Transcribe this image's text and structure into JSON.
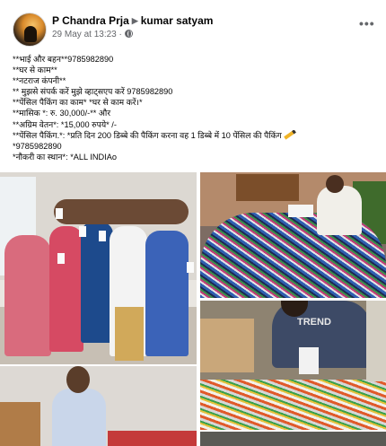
{
  "post": {
    "author": "P Chandra Prja",
    "recipient": "kumar satyam",
    "timestamp": "29 May at 13:23 ·",
    "body_lines": [
      "**भाई और बहन**9785982890",
      "**घर से काम**",
      "**नटराज कंपनी**",
      "** मुझसे संपर्क करें मुझे व्हाट्सएप करें 9785982890",
      "**पेंसिल पैकिंग का काम* *घर से काम करें।*",
      "**मासिक *: रु. 30,000/-** और",
      "**अग्रिम वेतन*: *15,000 रुपये* /-",
      "**पेंसिल पैकिंग.*: *प्रति दिन 200 डिब्बे की पैकिंग करना वह 1 डिब्बे में 10 पेंसिल की पैकिंग",
      "*9785982890",
      "*नौकरी का स्थान*: *ALL INDIAo"
    ],
    "photo_badge": "TREND"
  },
  "icons": {
    "more": "more-options-icon",
    "audience": "globe-icon",
    "arrow": "triangle-right-icon",
    "pencil": "pencil-emoji-icon"
  },
  "colors": {
    "text": "#050505",
    "meta": "#65676b"
  }
}
